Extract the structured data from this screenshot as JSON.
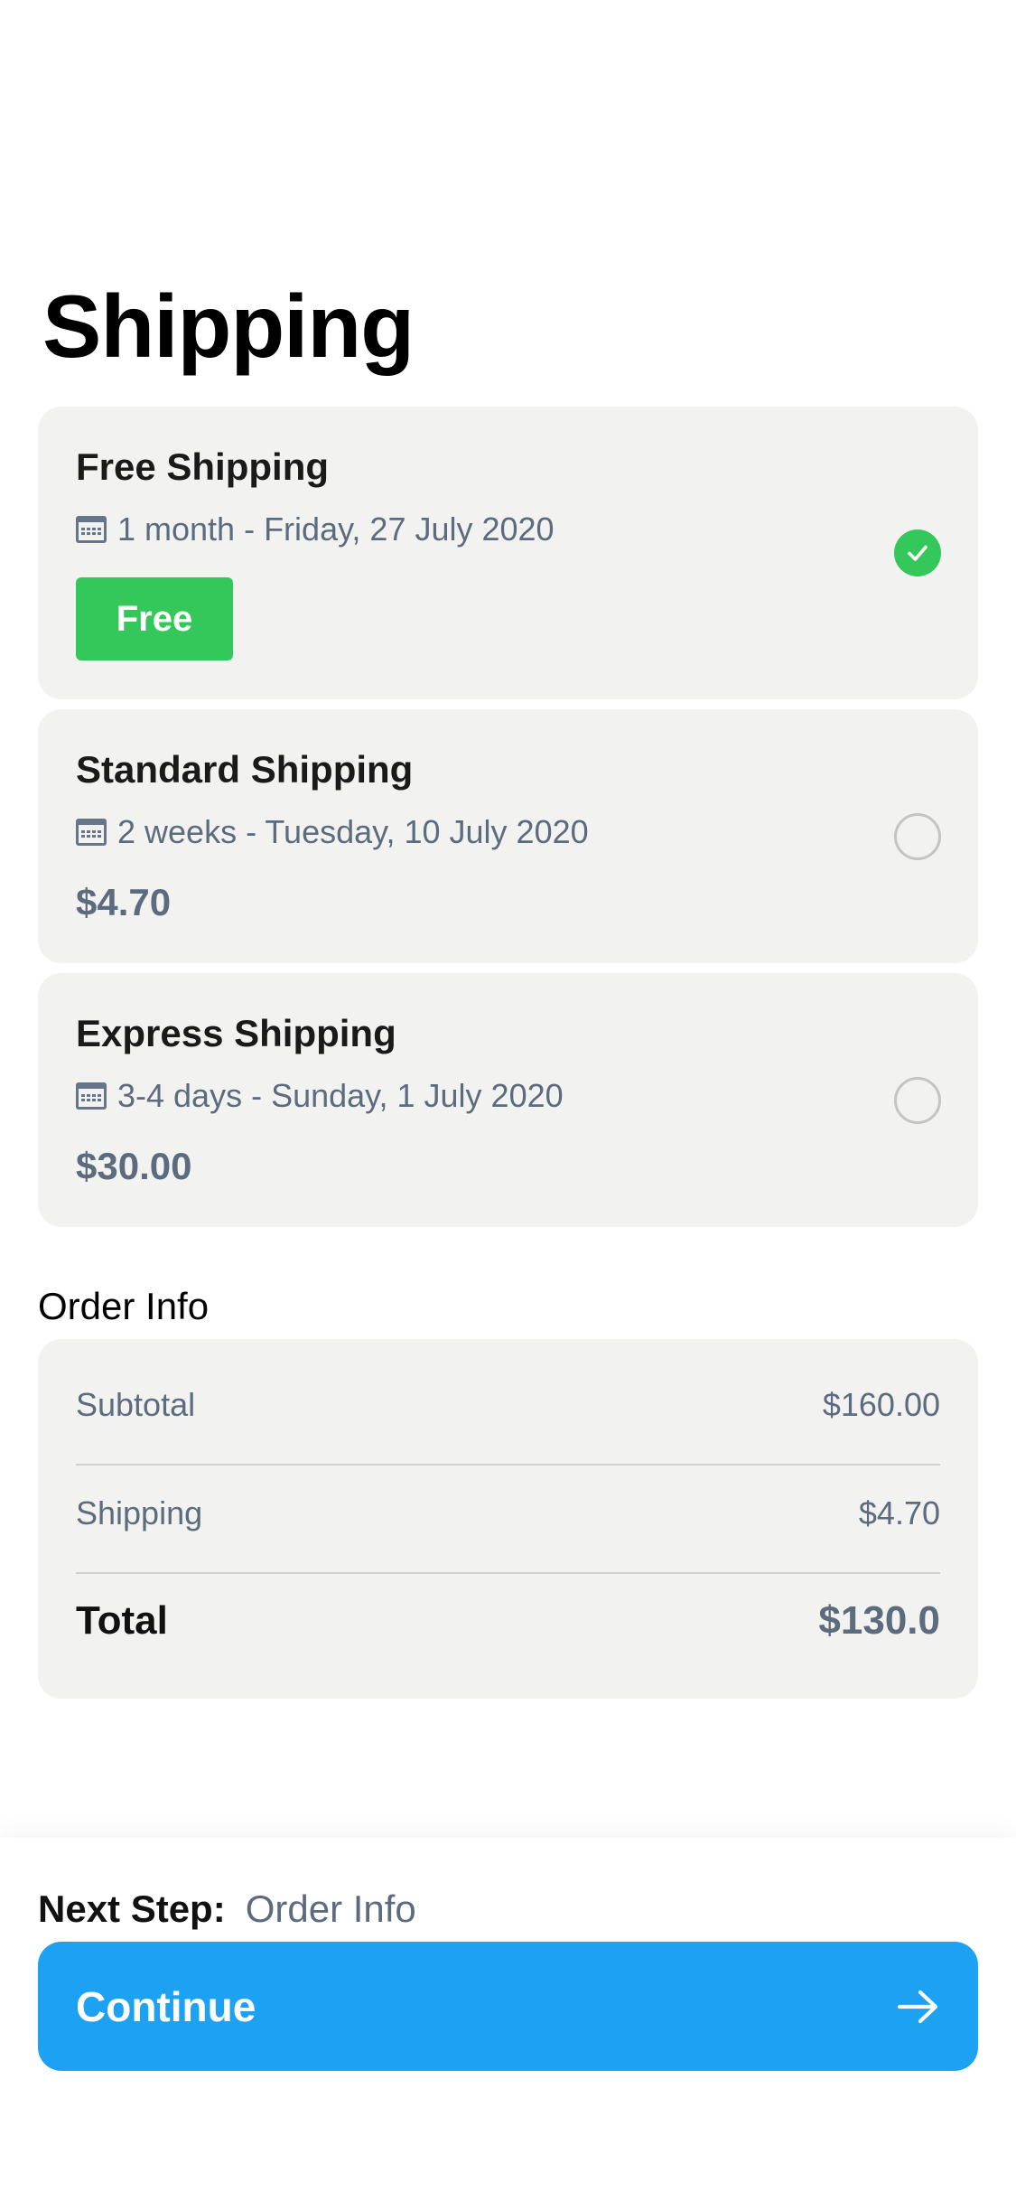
{
  "page": {
    "title": "Shipping"
  },
  "shipping_options": [
    {
      "title": "Free Shipping",
      "date": "1 month - Friday, 27 July 2020",
      "price": "Free",
      "selected": true
    },
    {
      "title": "Standard Shipping",
      "date": "2 weeks - Tuesday, 10 July 2020",
      "price": "$4.70",
      "selected": false
    },
    {
      "title": "Express Shipping",
      "date": "3-4 days - Sunday, 1 July 2020",
      "price": "$30.00",
      "selected": false
    }
  ],
  "order_info": {
    "title": "Order Info",
    "rows": [
      {
        "label": "Subtotal",
        "value": "$160.00"
      },
      {
        "label": "Shipping",
        "value": "$4.70"
      }
    ],
    "total": {
      "label": "Total",
      "value": "$130.0"
    }
  },
  "footer": {
    "next_step_label": "Next Step:",
    "next_step_value": "Order Info",
    "continue_label": "Continue"
  },
  "colors": {
    "accent": "#1da1f2",
    "selected": "#34c759",
    "card_bg": "#f2f2f1",
    "muted_text": "#5d6b7e"
  },
  "icons": {
    "date": "calendar-icon",
    "selected": "checkmark-icon",
    "continue": "arrow-right-icon"
  }
}
